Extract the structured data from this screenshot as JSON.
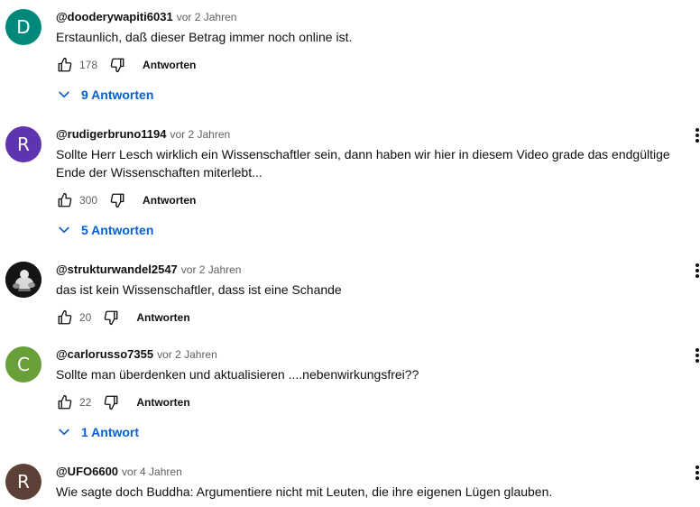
{
  "colors": {
    "reply_link": "#065fd4",
    "meta": "#606060"
  },
  "icons": {
    "like": "thumb-up-icon",
    "dislike": "thumb-down-icon",
    "more": "more-vert-icon",
    "expand": "chevron-down-icon"
  },
  "comments": [
    {
      "avatar_letter": "D",
      "avatar_color": "#00897b",
      "author": "@dooderywapiti6031",
      "time": "vor 2 Jahren",
      "text": "Erstaunlich, daß dieser Betrag immer noch online ist.",
      "likes": "178",
      "reply_label": "Antworten",
      "replies_label": "9 Antworten"
    },
    {
      "avatar_letter": "R",
      "avatar_color": "#5e35b1",
      "author": "@rudigerbruno1194",
      "time": "vor 2 Jahren",
      "text": "Sollte Herr Lesch wirklich ein Wissenschaftler sein, dann haben wir hier in diesem Video grade das endgültige Ende der Wissenschaften miterlebt...",
      "likes": "300",
      "reply_label": "Antworten",
      "replies_label": "5 Antworten"
    },
    {
      "avatar_letter": "",
      "avatar_color": "#121212",
      "author": "@strukturwandel2547",
      "time": "vor 2 Jahren",
      "text": "das ist kein Wissenschaftler, dass ist eine Schande",
      "likes": "20",
      "reply_label": "Antworten"
    },
    {
      "avatar_letter": "C",
      "avatar_color": "#689f38",
      "author": "@carlorusso7355",
      "time": "vor 2 Jahren",
      "text": "Sollte man überdenken und aktualisieren ....nebenwirkungsfrei??",
      "likes": "22",
      "reply_label": "Antworten",
      "replies_label": "1 Antwort"
    },
    {
      "avatar_letter": "R",
      "avatar_color": "#5d4037",
      "author": "@UFO6600",
      "time": "vor 4 Jahren",
      "text": "Wie sagte doch Buddha: Argumentiere nicht mit Leuten, die ihre eigenen Lügen glauben."
    }
  ]
}
